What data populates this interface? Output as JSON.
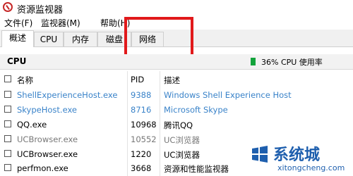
{
  "window": {
    "title": "资源监视器"
  },
  "menu": [
    "文件(F)",
    "监视器(M)",
    "帮助(H)"
  ],
  "tabs": [
    "概述",
    "CPU",
    "内存",
    "磁盘",
    "网络"
  ],
  "active_tab": "概述",
  "section": {
    "title": "CPU",
    "usage": "36% CPU 使用率",
    "usage_percent": 36,
    "indicator_color": "#12a33b"
  },
  "table": {
    "headers": {
      "name": "名称",
      "pid": "PID",
      "desc": "描述"
    },
    "rows": [
      {
        "name": "ShellExperienceHost.exe",
        "pid": "9388",
        "desc": "Windows Shell Experience Host",
        "style": "blue"
      },
      {
        "name": "SkypeHost.exe",
        "pid": "8716",
        "desc": "Microsoft Skype",
        "style": "blue"
      },
      {
        "name": "QQ.exe",
        "pid": "10968",
        "desc": "腾讯QQ",
        "style": "normal"
      },
      {
        "name": "UCBrowser.exe",
        "pid": "10552",
        "desc": "UC浏览器",
        "style": "gray"
      },
      {
        "name": "UCBrowser.exe",
        "pid": "1220",
        "desc": "UC浏览器",
        "style": "normal"
      },
      {
        "name": "perfmon.exe",
        "pid": "3668",
        "desc": "资源和性能监视器",
        "style": "normal"
      },
      {
        "name": "",
        "pid": "",
        "desc": "",
        "style": "normal"
      }
    ]
  },
  "watermark": {
    "title": "系统城",
    "url": "xitongcheng.com"
  },
  "colors": {
    "highlight": "#e1191b",
    "link_blue": "#3a83c9",
    "brand_blue": "#1e5fae"
  }
}
